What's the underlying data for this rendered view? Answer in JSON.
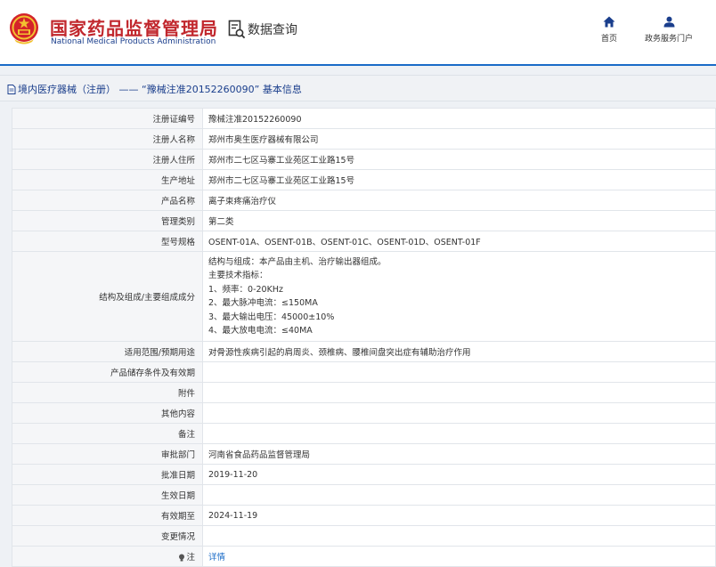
{
  "header": {
    "title": "国家药品监督管理局",
    "subtitle": "National Medical Products Administration",
    "query_label": "数据查询",
    "nav": [
      {
        "label": "首页",
        "icon": "home-icon"
      },
      {
        "label": "政务服务门户",
        "icon": "user-icon"
      }
    ]
  },
  "breadcrumb": {
    "text": "境内医疗器械（注册） —— “豫械注准20152260090” 基本信息"
  },
  "details": {
    "rows": [
      {
        "label": "注册证编号",
        "value": "豫械注准20152260090"
      },
      {
        "label": "注册人名称",
        "value": "郑州市奥生医疗器械有限公司"
      },
      {
        "label": "注册人住所",
        "value": "郑州市二七区马寨工业苑区工业路15号"
      },
      {
        "label": "生产地址",
        "value": "郑州市二七区马寨工业苑区工业路15号"
      },
      {
        "label": "产品名称",
        "value": "离子束疼痛治疗仪"
      },
      {
        "label": "管理类别",
        "value": "第二类"
      },
      {
        "label": "型号规格",
        "value": "OSENT-01A、OSENT-01B、OSENT-01C、OSENT-01D、OSENT-01F"
      },
      {
        "label": "结构及组成/主要组成成分",
        "lines": [
          "结构与组成：本产品由主机、治疗输出器组成。",
          "主要技术指标：",
          "1、频率：0-20KHz",
          "2、最大脉冲电流：≤150MA",
          "3、最大输出电压：45000±10%",
          "4、最大放电电流：≤40MA"
        ]
      },
      {
        "label": "适用范围/预期用途",
        "value": "对骨源性疾病引起的肩周炎、颈椎病、腰椎间盘突出症有辅助治疗作用"
      },
      {
        "label": "产品储存条件及有效期",
        "value": ""
      },
      {
        "label": "附件",
        "value": ""
      },
      {
        "label": "其他内容",
        "value": ""
      },
      {
        "label": "备注",
        "value": ""
      },
      {
        "label": "审批部门",
        "value": "河南省食品药品监督管理局"
      },
      {
        "label": "批准日期",
        "value": "2019-11-20"
      },
      {
        "label": "生效日期",
        "value": ""
      },
      {
        "label": "有效期至",
        "value": "2024-11-19"
      },
      {
        "label": "变更情况",
        "value": ""
      },
      {
        "label": "注",
        "value": "详情"
      }
    ]
  },
  "colors": {
    "title_red": "#c1272d",
    "brand_blue": "#1a3e8c",
    "link_blue": "#1a6bc7"
  }
}
